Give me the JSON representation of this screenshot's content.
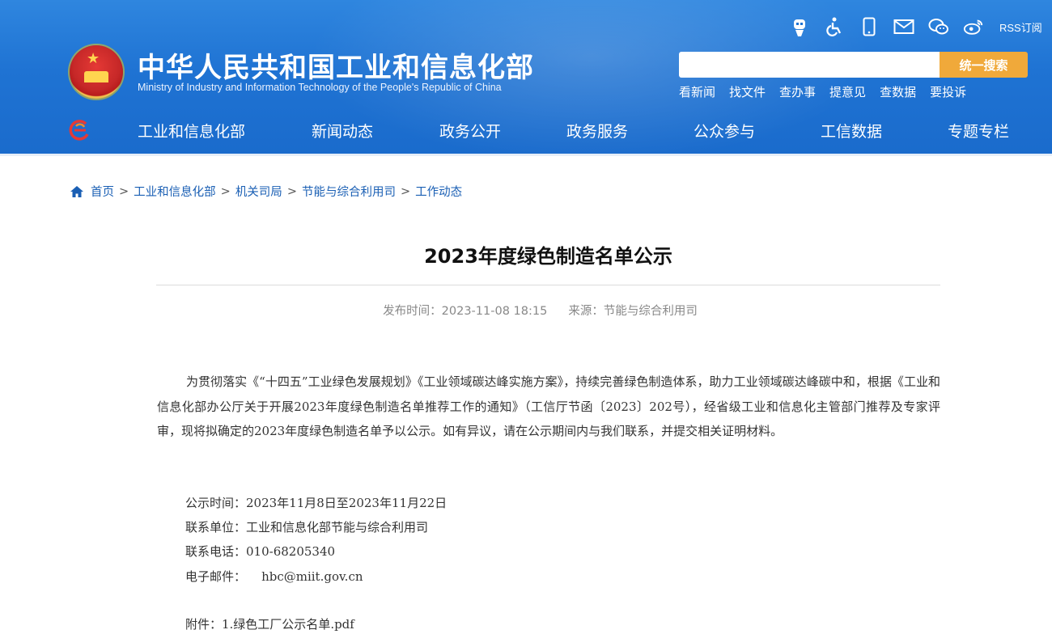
{
  "header": {
    "site_title": "中华人民共和国工业和信息化部",
    "site_subtitle": "Ministry of Industry and Information Technology of the People's Republic of China",
    "top_icons": [
      "robot-icon",
      "accessibility-icon",
      "mobile-icon",
      "mail-icon",
      "wechat-icon",
      "weibo-icon"
    ],
    "rss_label": "RSS订阅",
    "search_placeholder": "",
    "search_button": "统一搜索",
    "quick_links": [
      "看新闻",
      "找文件",
      "查办事",
      "提意见",
      "查数据",
      "要投诉"
    ],
    "nav": [
      "工业和信息化部",
      "新闻动态",
      "政务公开",
      "政务服务",
      "公众参与",
      "工信数据",
      "专题专栏"
    ]
  },
  "breadcrumb": [
    "首页",
    "工业和信息化部",
    "机关司局",
    "节能与综合利用司",
    "工作动态"
  ],
  "article": {
    "title": "2023年度绿色制造名单公示",
    "publish_time": "发布时间：2023-11-08 18:15",
    "source": "来源：节能与综合利用司",
    "paragraph": "为贯彻落实《“十四五”工业绿色发展规划》《工业领域碳达峰实施方案》，持续完善绿色制造体系，助力工业领域碳达峰碳中和，根据《工业和信息化部办公厅关于开展2023年度绿色制造名单推荐工作的通知》（工信厅节函〔2023〕202号），经省级工业和信息化主管部门推荐及专家评审，现将拟确定的2023年度绿色制造名单予以公示。如有异议，请在公示期间内与我们联系，并提交相关证明材料。",
    "period": "公示时间：2023年11月8日至2023年11月22日",
    "contact_unit": "联系单位：工业和信息化部节能与综合利用司",
    "phone": "联系电话：010-68205340",
    "email": "电子邮件：    hbc@miit.gov.cn",
    "attachment": "附件：1.绿色工厂公示名单.pdf"
  },
  "colors": {
    "header_blue": "#1f73d3",
    "search_button": "#f0a93a",
    "link_blue": "#1a5fb4"
  }
}
